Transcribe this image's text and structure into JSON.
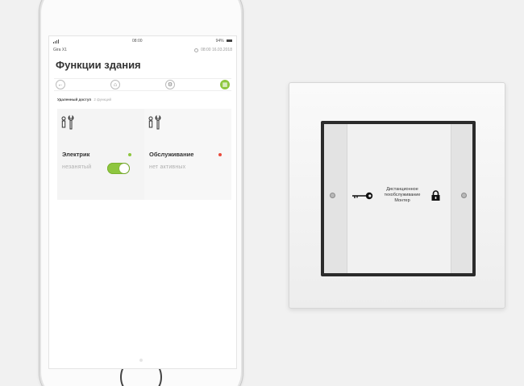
{
  "phone": {
    "status_bar": {
      "time": "08:00",
      "battery": "94%"
    },
    "app_name": "Gira X1",
    "datetime": "08:00  16.03.2018",
    "title": "Функции здания",
    "nav": {
      "back_icon": "arrow-left-icon",
      "home_icon": "house-icon",
      "settings_icon": "gear-icon",
      "active_icon": "function-icon"
    },
    "section": {
      "label": "Удаленный доступ",
      "count": "2 функций"
    },
    "tiles": [
      {
        "label": "Электрик",
        "status": "незанятый",
        "indicator": "green",
        "toggle_on": true,
        "icon": "person-wrench-icon"
      },
      {
        "label": "Обслуживание",
        "status": "нет активных",
        "indicator": "red",
        "icon": "person-wrench-icon"
      }
    ]
  },
  "wall_switch": {
    "label_lines": [
      "Дистанционное",
      "техобслуживание",
      "Монтер"
    ],
    "key_icon": "key-icon",
    "lock_icon": "lock-icon"
  },
  "colors": {
    "accent_green": "#8ec63f",
    "indicator_red": "#e94b3c",
    "background": "#f1f1f1"
  }
}
